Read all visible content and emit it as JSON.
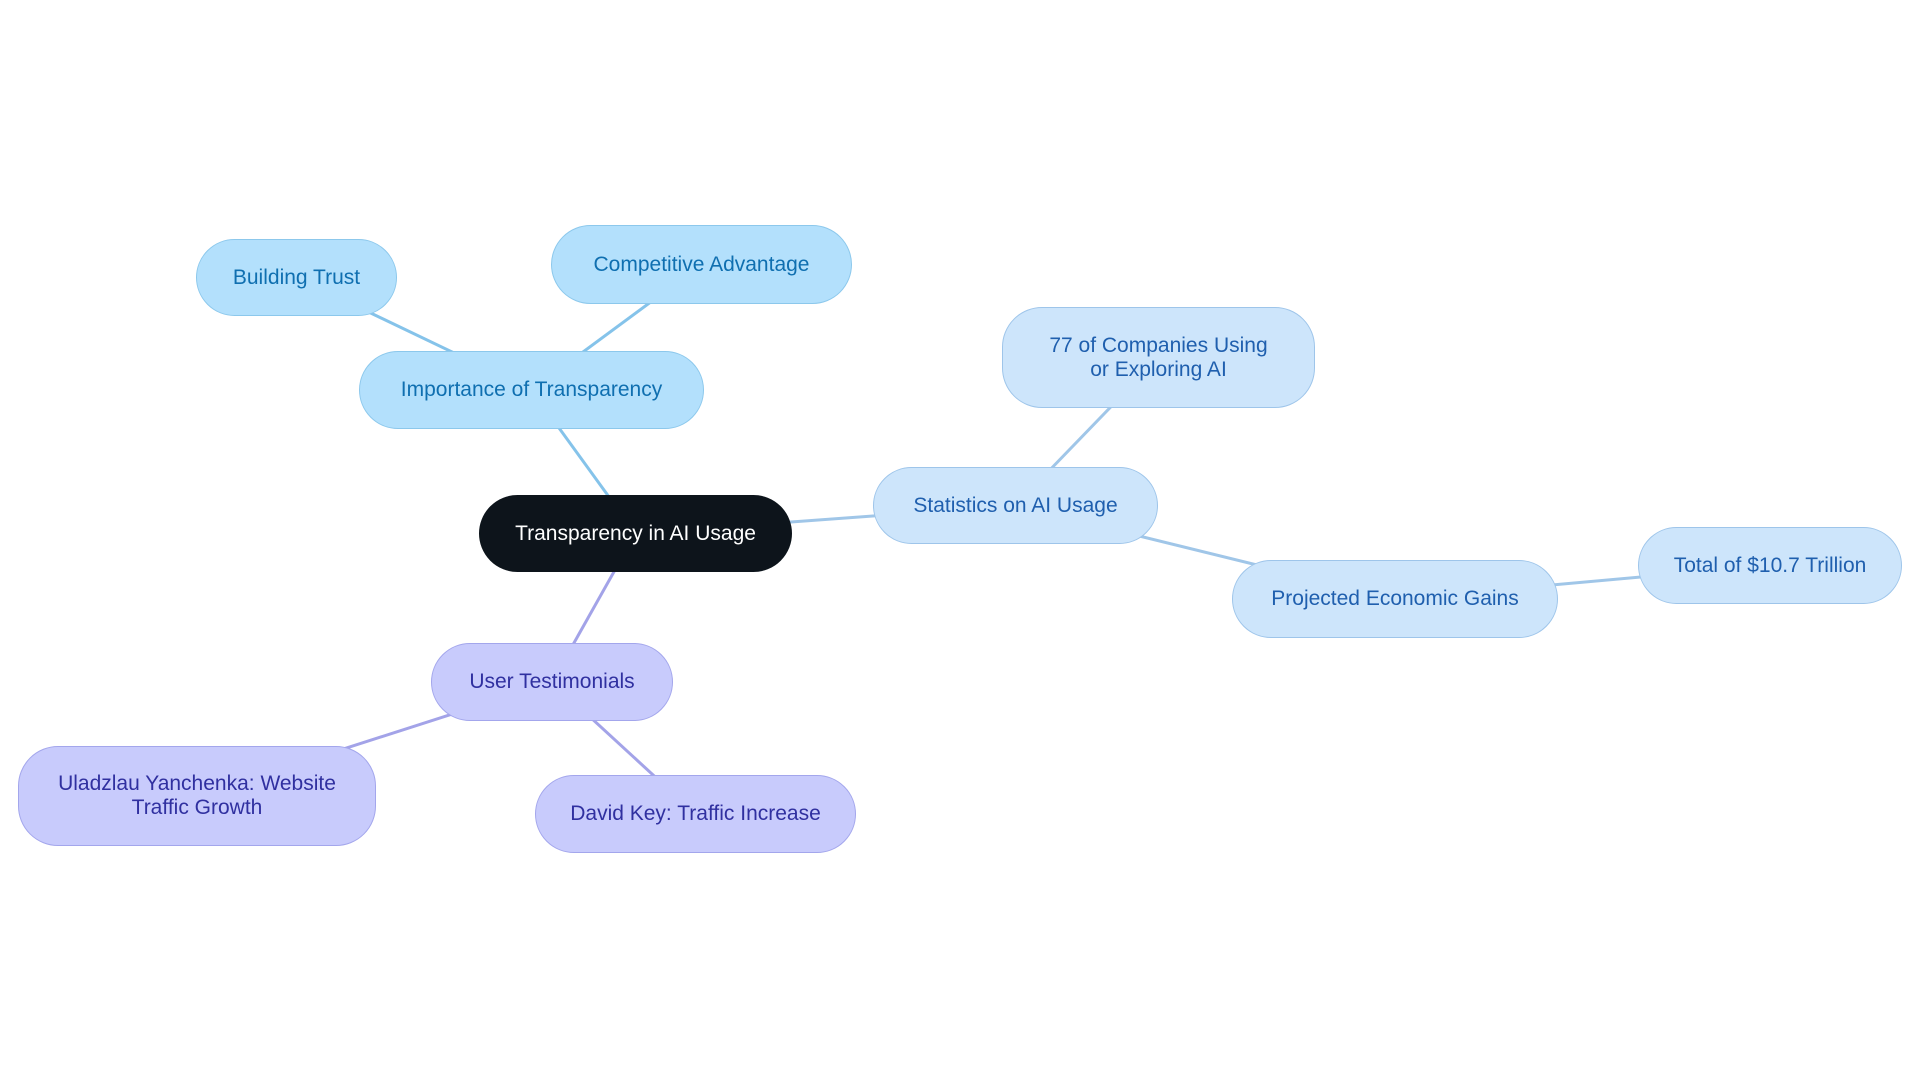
{
  "diagram": {
    "type": "mindmap",
    "root": {
      "id": "root",
      "label": "Transparency in AI Usage"
    },
    "branches": [
      {
        "id": "importance",
        "label": "Importance of Transparency",
        "color_group": "cyan",
        "children": [
          {
            "id": "trust",
            "label": "Building Trust"
          },
          {
            "id": "competitive",
            "label": "Competitive Advantage"
          }
        ]
      },
      {
        "id": "statistics",
        "label": "Statistics on AI Usage",
        "color_group": "blue",
        "children": [
          {
            "id": "companies",
            "label": "77 of Companies Using or Exploring AI"
          },
          {
            "id": "gains",
            "label": "Projected Economic Gains",
            "children": [
              {
                "id": "total",
                "label": "Total of $10.7 Trillion"
              }
            ]
          }
        ]
      },
      {
        "id": "testimonials",
        "label": "User Testimonials",
        "color_group": "purple",
        "children": [
          {
            "id": "uladzlau",
            "label": "Uladzlau Yanchenka: Website Traffic Growth"
          },
          {
            "id": "david",
            "label": "David Key: Traffic Increase"
          }
        ]
      }
    ],
    "colors": {
      "root_fill": "#0d141b",
      "root_text": "#ffffff",
      "cyan_fill": "#b3e0fc",
      "cyan_text": "#0f6fb0",
      "cyan_edge": "#85c3ea",
      "blue_fill": "#cde5fb",
      "blue_text": "#1f5fae",
      "blue_edge": "#a0c6e8",
      "purple_fill": "#c8cbfc",
      "purple_text": "#3030a0",
      "purple_edge": "#a3a3e8"
    }
  }
}
